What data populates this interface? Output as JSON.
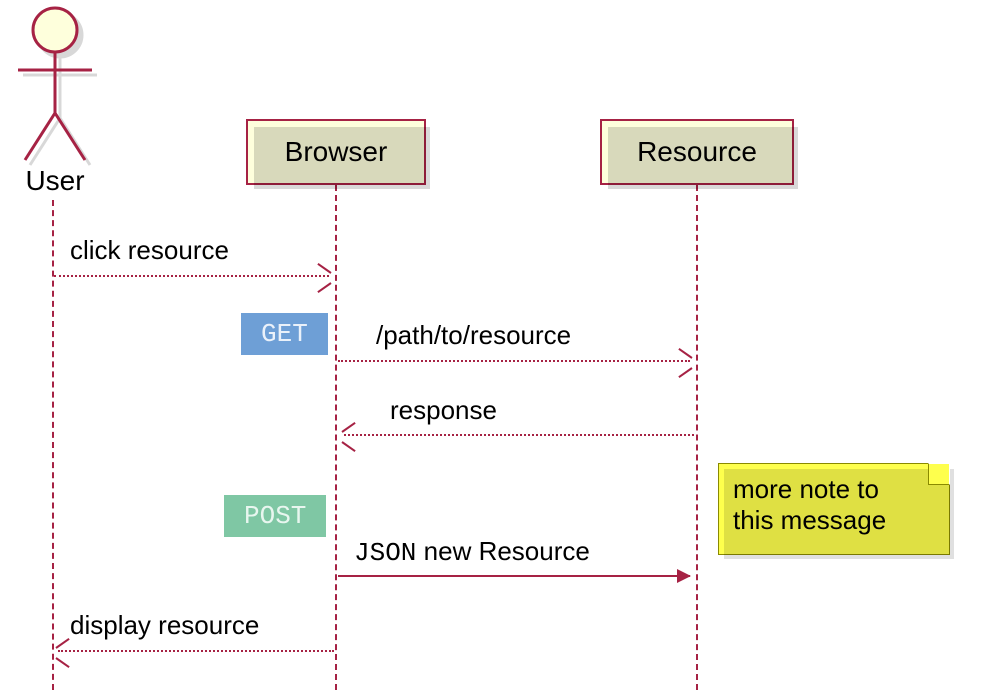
{
  "participants": {
    "user": {
      "label": "User",
      "type": "actor"
    },
    "browser": {
      "label": "Browser",
      "type": "box"
    },
    "resource": {
      "label": "Resource",
      "type": "box"
    }
  },
  "badges": {
    "get": "GET",
    "post": "POST"
  },
  "messages": {
    "m1": {
      "from": "user",
      "to": "browser",
      "text": "click resource",
      "style": "dotted",
      "dir": "right"
    },
    "m2": {
      "from": "browser",
      "to": "resource",
      "text": "/path/to/resource",
      "style": "dotted",
      "dir": "right",
      "badge": "get"
    },
    "m3": {
      "from": "resource",
      "to": "browser",
      "text": "response",
      "style": "dotted",
      "dir": "left"
    },
    "m4": {
      "from": "browser",
      "to": "resource",
      "text_prefix_mono": "JSON",
      "text_rest": " new Resource",
      "style": "solid",
      "dir": "right",
      "badge": "post",
      "note": "more note to\nthis message"
    },
    "m5": {
      "from": "browser",
      "to": "user",
      "text": "display resource",
      "style": "dotted",
      "dir": "left"
    }
  },
  "note_lines": {
    "l1": "more note to",
    "l2": "this message"
  }
}
